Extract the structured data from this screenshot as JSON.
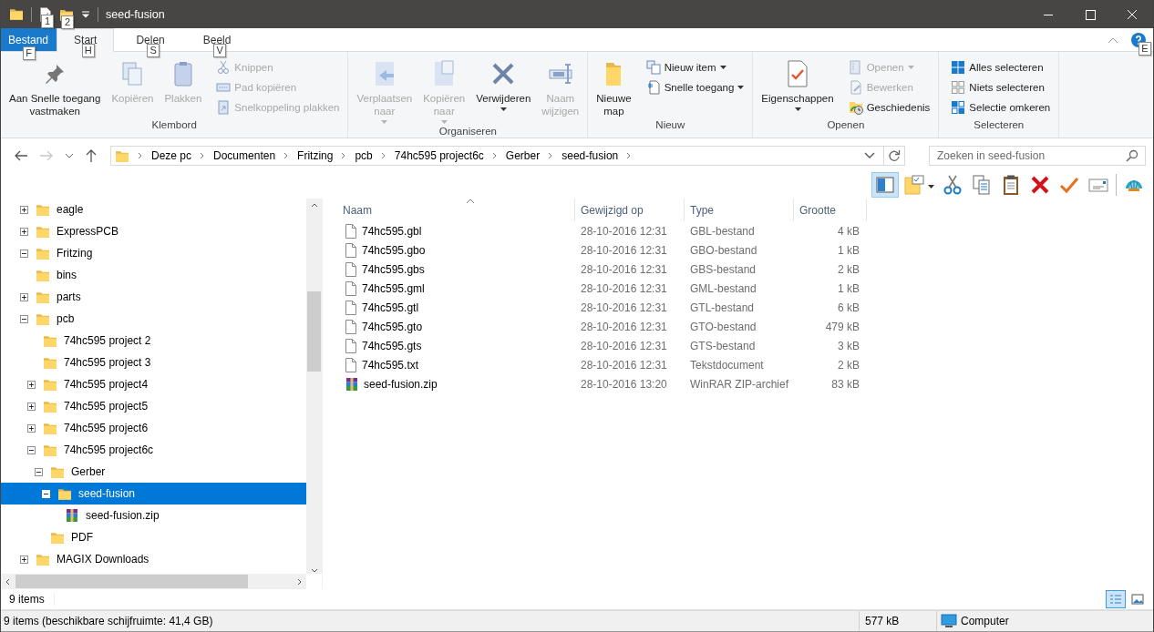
{
  "window": {
    "title": "seed-fusion",
    "quick_access_keytips": [
      "1",
      "2"
    ]
  },
  "ribbon_tabs": [
    {
      "label": "Bestand",
      "kind": "file",
      "keytip": "F",
      "selected": false
    },
    {
      "label": "Start",
      "kind": "tab",
      "keytip": "H",
      "selected": true
    },
    {
      "label": "Delen",
      "kind": "tab",
      "keytip": "S",
      "selected": false
    },
    {
      "label": "Beeld",
      "kind": "tab",
      "keytip": "V",
      "selected": false
    }
  ],
  "help_keytip": "E",
  "ribbon_groups": [
    {
      "label": "Klembord",
      "items": [
        {
          "kind": "large",
          "label": "Aan Snelle toegang\nvastmaken",
          "disabled": false,
          "dropdown": false
        },
        {
          "kind": "large",
          "label": "Kopiëren",
          "disabled": true,
          "dropdown": false
        },
        {
          "kind": "large",
          "label": "Plakken",
          "disabled": true,
          "dropdown": false
        },
        {
          "kind": "small",
          "label": "Knippen",
          "disabled": true,
          "dropdown": false
        },
        {
          "kind": "small",
          "label": "Pad kopiëren",
          "disabled": true,
          "dropdown": false
        },
        {
          "kind": "small",
          "label": "Snelkoppeling plakken",
          "disabled": true,
          "dropdown": false
        }
      ]
    },
    {
      "label": "Organiseren",
      "items": [
        {
          "kind": "large",
          "label": "Verplaatsen\nnaar",
          "disabled": true,
          "dropdown": true
        },
        {
          "kind": "large",
          "label": "Kopiëren\nnaar",
          "disabled": true,
          "dropdown": true
        },
        {
          "kind": "large",
          "label": "Verwijderen",
          "disabled": false,
          "dropdown": true
        },
        {
          "kind": "large",
          "label": "Naam\nwijzigen",
          "disabled": true,
          "dropdown": false
        }
      ]
    },
    {
      "label": "Nieuw",
      "items": [
        {
          "kind": "large",
          "label": "Nieuwe\nmap",
          "disabled": false,
          "dropdown": false
        },
        {
          "kind": "small",
          "label": "Nieuw item",
          "disabled": false,
          "dropdown": true
        },
        {
          "kind": "small",
          "label": "Snelle toegang",
          "disabled": false,
          "dropdown": true
        }
      ]
    },
    {
      "label": "Openen",
      "items": [
        {
          "kind": "large",
          "label": "Eigenschappen",
          "disabled": false,
          "dropdown": true
        },
        {
          "kind": "small",
          "label": "Openen",
          "disabled": true,
          "dropdown": true
        },
        {
          "kind": "small",
          "label": "Bewerken",
          "disabled": true,
          "dropdown": false
        },
        {
          "kind": "small",
          "label": "Geschiedenis",
          "disabled": false,
          "dropdown": false
        }
      ]
    },
    {
      "label": "Selecteren",
      "items": [
        {
          "kind": "small",
          "label": "Alles selecteren",
          "disabled": false,
          "dropdown": false
        },
        {
          "kind": "small",
          "label": "Niets selecteren",
          "disabled": false,
          "dropdown": false
        },
        {
          "kind": "small",
          "label": "Selectie omkeren",
          "disabled": false,
          "dropdown": false
        }
      ]
    }
  ],
  "breadcrumb": [
    "Deze pc",
    "Documenten",
    "Fritzing",
    "pcb",
    "74hc595 project6c",
    "Gerber",
    "seed-fusion"
  ],
  "search": {
    "placeholder": "Zoeken in seed-fusion"
  },
  "toolbar": [
    {
      "selected": true,
      "dropdown": false
    },
    {
      "selected": false,
      "dropdown": true
    },
    {
      "selected": false,
      "dropdown": false
    },
    {
      "selected": false,
      "dropdown": false
    },
    {
      "selected": false,
      "dropdown": false
    },
    {
      "selected": false,
      "dropdown": false
    },
    {
      "selected": false,
      "dropdown": false
    },
    {
      "selected": false,
      "dropdown": false
    },
    {
      "selected": false,
      "dropdown": false
    }
  ],
  "tree": [
    {
      "label": "eagle",
      "kind": "folder",
      "expanded": false,
      "selected": false
    },
    {
      "label": "ExpressPCB",
      "kind": "folder",
      "expanded": false,
      "selected": false
    },
    {
      "label": "Fritzing",
      "kind": "folder",
      "expanded": true,
      "selected": false,
      "children": [
        {
          "label": "bins",
          "kind": "folder",
          "selected": false
        },
        {
          "label": "parts",
          "kind": "folder",
          "expanded": false,
          "selected": false
        },
        {
          "label": "pcb",
          "kind": "folder",
          "expanded": true,
          "selected": false,
          "children": [
            {
              "label": "74hc595 project 2",
              "kind": "folder",
              "selected": false
            },
            {
              "label": "74hc595 project 3",
              "kind": "folder",
              "selected": false
            },
            {
              "label": "74hc595 project4",
              "kind": "folder",
              "expanded": false,
              "selected": false
            },
            {
              "label": "74hc595 project5",
              "kind": "folder",
              "expanded": false,
              "selected": false
            },
            {
              "label": "74hc595 project6",
              "kind": "folder",
              "expanded": false,
              "selected": false
            },
            {
              "label": "74hc595 project6c",
              "kind": "folder",
              "expanded": true,
              "selected": false,
              "children": [
                {
                  "label": "Gerber",
                  "kind": "folder",
                  "expanded": true,
                  "selected": false,
                  "children": [
                    {
                      "label": "seed-fusion",
                      "kind": "folder",
                      "expanded": true,
                      "selected": true,
                      "children": [
                        {
                          "label": "seed-fusion.zip",
                          "kind": "archive",
                          "selected": false
                        }
                      ]
                    }
                  ]
                },
                {
                  "label": "PDF",
                  "kind": "folder",
                  "selected": false
                }
              ]
            }
          ]
        }
      ]
    },
    {
      "label": "MAGIX Downloads",
      "kind": "folder",
      "expanded": false,
      "selected": false
    }
  ],
  "table": {
    "columns": [
      "Naam",
      "Gewijzigd op",
      "Type",
      "Grootte"
    ],
    "rows": [
      {
        "kind": "file",
        "cells": [
          "74hc595.gbl",
          "28-10-2016 12:31",
          "GBL-bestand",
          "4 kB"
        ]
      },
      {
        "kind": "file",
        "cells": [
          "74hc595.gbo",
          "28-10-2016 12:31",
          "GBO-bestand",
          "1 kB"
        ]
      },
      {
        "kind": "file",
        "cells": [
          "74hc595.gbs",
          "28-10-2016 12:31",
          "GBS-bestand",
          "2 kB"
        ]
      },
      {
        "kind": "file",
        "cells": [
          "74hc595.gml",
          "28-10-2016 12:31",
          "GML-bestand",
          "1 kB"
        ]
      },
      {
        "kind": "file",
        "cells": [
          "74hc595.gtl",
          "28-10-2016 12:31",
          "GTL-bestand",
          "6 kB"
        ]
      },
      {
        "kind": "file",
        "cells": [
          "74hc595.gto",
          "28-10-2016 12:31",
          "GTO-bestand",
          "479 kB"
        ]
      },
      {
        "kind": "file",
        "cells": [
          "74hc595.gts",
          "28-10-2016 12:31",
          "GTS-bestand",
          "3 kB"
        ]
      },
      {
        "kind": "file",
        "cells": [
          "74hc595.txt",
          "28-10-2016 12:31",
          "Tekstdocument",
          "2 kB"
        ]
      },
      {
        "kind": "archive",
        "cells": [
          "seed-fusion.zip",
          "28-10-2016 13:20",
          "WinRAR ZIP-archief",
          "83 kB"
        ]
      }
    ]
  },
  "item_count": "9 items",
  "view_buttons": [
    {
      "selected": true
    },
    {
      "selected": false
    }
  ],
  "status_bar": {
    "text": "9 items (beschikbare schijfruimte: 41,4 GB)",
    "size": "577 kB",
    "zone": "Computer"
  }
}
